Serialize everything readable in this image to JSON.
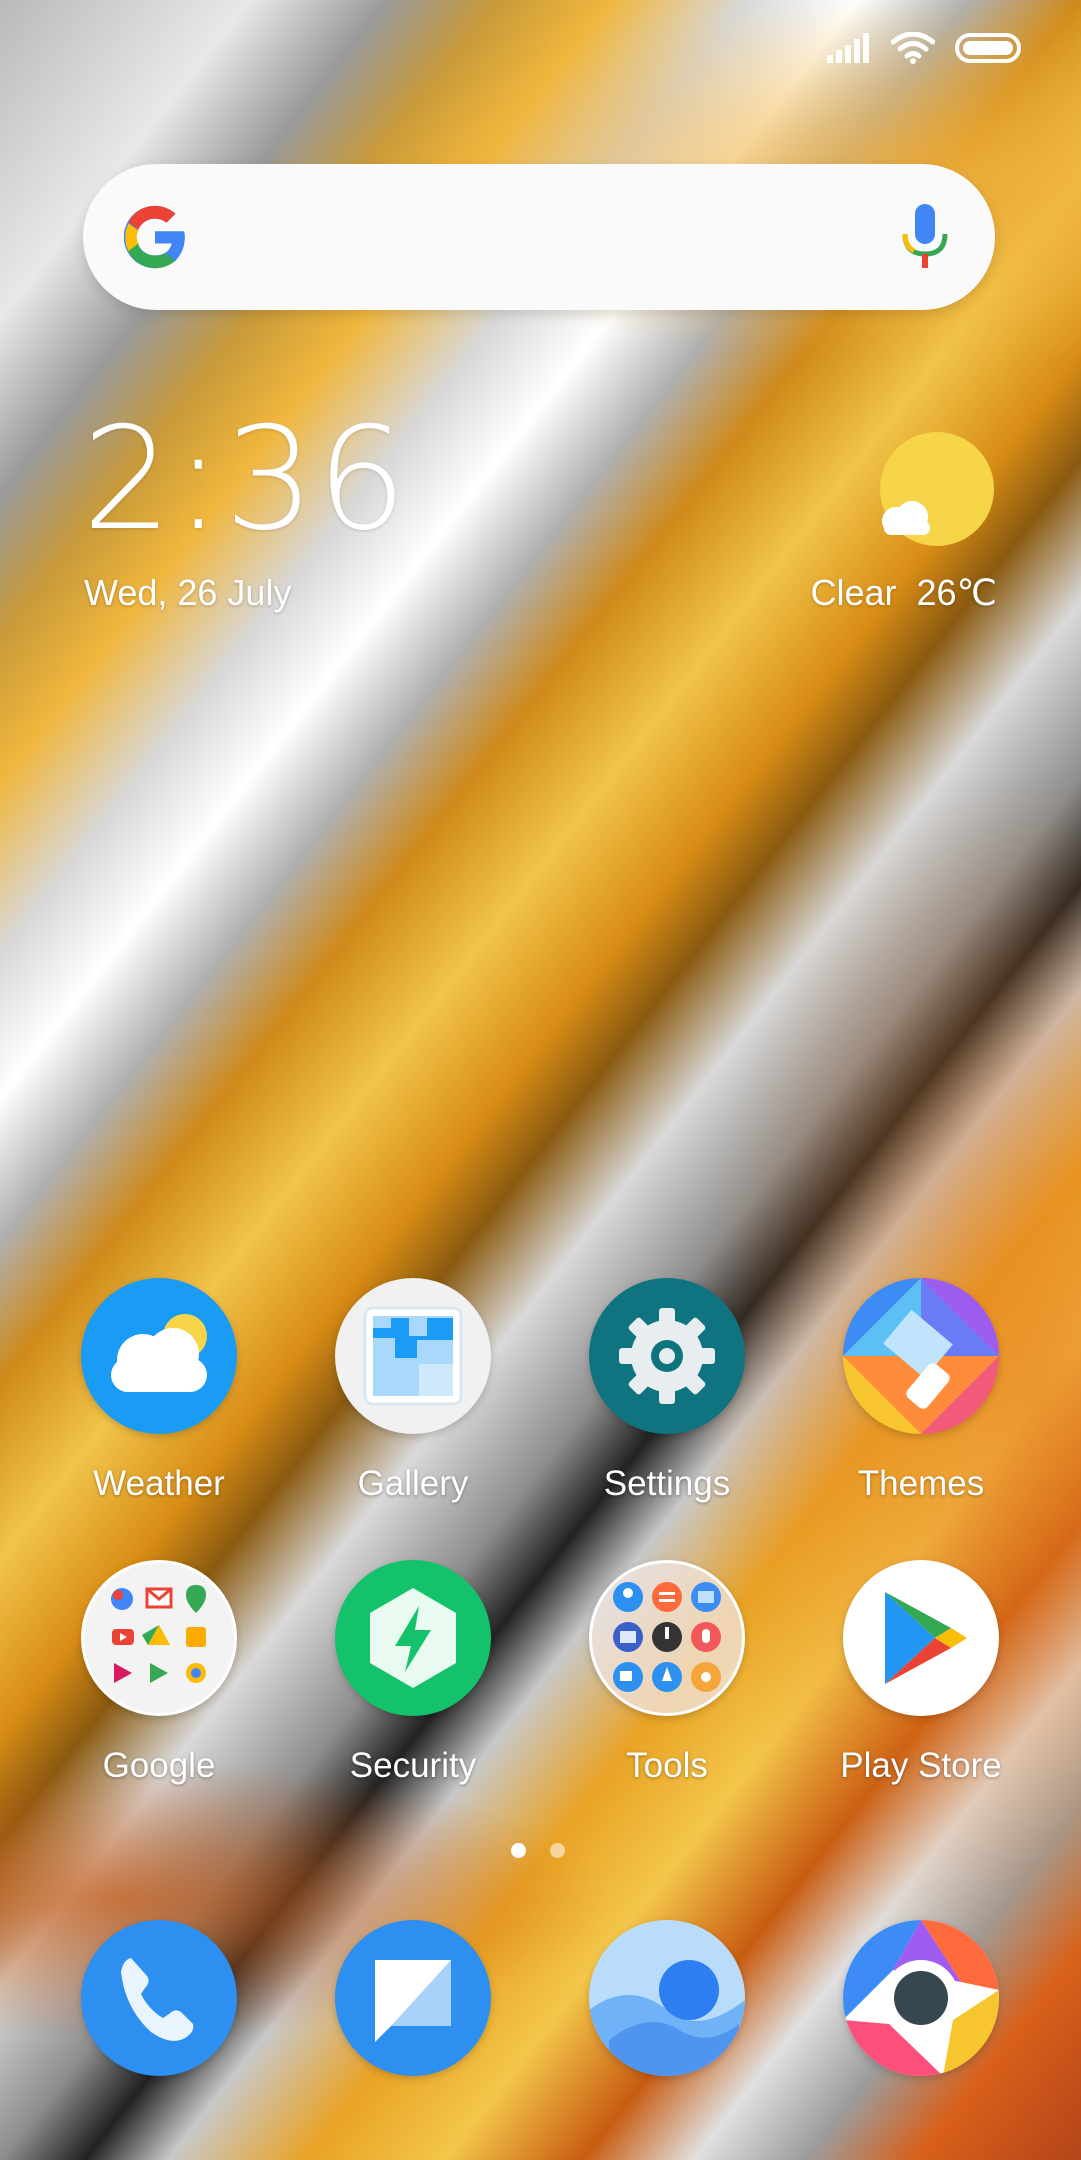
{
  "status_bar": {
    "icons": [
      "signal-icon",
      "wifi-icon",
      "battery-icon"
    ]
  },
  "search": {
    "logo": "google-g-icon",
    "mic": "mic-icon"
  },
  "clock": {
    "time": "2:36",
    "date": "Wed, 26 July"
  },
  "weather_widget": {
    "condition": "Clear",
    "temperature": "26℃",
    "text": "Clear  26℃"
  },
  "apps": [
    {
      "label": "Weather",
      "icon": "weather-icon"
    },
    {
      "label": "Gallery",
      "icon": "gallery-icon"
    },
    {
      "label": "Settings",
      "icon": "gear-icon"
    },
    {
      "label": "Themes",
      "icon": "themes-brush-icon"
    },
    {
      "label": "Google",
      "icon": "google-folder-icon"
    },
    {
      "label": "Security",
      "icon": "security-bolt-icon"
    },
    {
      "label": "Tools",
      "icon": "tools-folder-icon"
    },
    {
      "label": "Play Store",
      "icon": "play-store-icon"
    }
  ],
  "page_indicator": {
    "pages": 2,
    "current": 1
  },
  "dock": [
    {
      "icon": "phone-icon"
    },
    {
      "icon": "messages-icon"
    },
    {
      "icon": "browser-icon"
    },
    {
      "icon": "chrome-icon"
    }
  ],
  "colors": {
    "weather_blue": "#1a9bf5",
    "settings_teal": "#0f7480",
    "security_green": "#14c26b",
    "dock_blue": "#2d8ff0",
    "sun_yellow": "#f6d548"
  }
}
